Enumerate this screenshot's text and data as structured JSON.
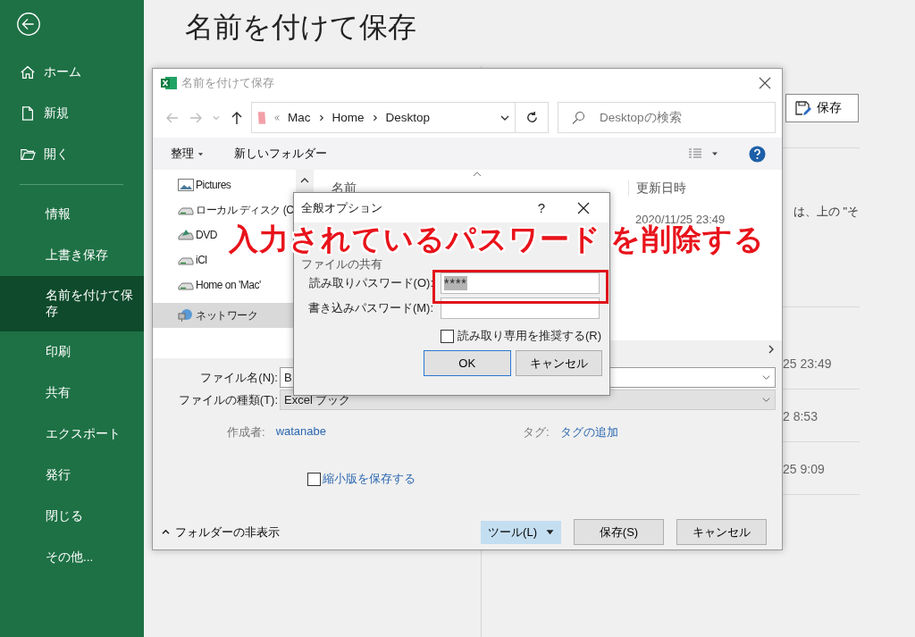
{
  "sidebar": {
    "items": [
      {
        "label": "ホーム",
        "kind": "home",
        "selected": false
      },
      {
        "label": "新規",
        "kind": "new",
        "selected": false
      },
      {
        "label": "開く",
        "kind": "open",
        "selected": false
      },
      {
        "label": "情報",
        "kind": "page",
        "selected": false
      },
      {
        "label": "上書き保存",
        "kind": "page",
        "selected": false
      },
      {
        "label": "名前を付けて保存",
        "kind": "page",
        "selected": true
      },
      {
        "label": "印刷",
        "kind": "page",
        "selected": false
      },
      {
        "label": "共有",
        "kind": "page",
        "selected": false
      },
      {
        "label": "エクスポート",
        "kind": "page",
        "selected": false
      },
      {
        "label": "発行",
        "kind": "page",
        "selected": false
      },
      {
        "label": "閉じる",
        "kind": "page",
        "selected": false
      },
      {
        "label": "その他...",
        "kind": "page",
        "selected": false
      }
    ]
  },
  "page_title": "名前を付けて保存",
  "backstage": {
    "save_button": "保存",
    "note": "は、上の \"そ",
    "times": [
      "25 23:49",
      "2 8:53",
      "25 9:09"
    ]
  },
  "save_dialog": {
    "title": "名前を付けて保存",
    "breadcrumb": [
      "Mac",
      "Home",
      "Desktop"
    ],
    "search": {
      "placeholder": "Desktopの検索"
    },
    "toolbar": {
      "organize": "整理",
      "new_folder": "新しいフォルダー"
    },
    "nav": [
      {
        "label": "Pictures",
        "kind": "pictures",
        "selected": false
      },
      {
        "label": "ローカル ディスク (C",
        "kind": "drive",
        "selected": false
      },
      {
        "label": "DVD",
        "kind": "dvd",
        "selected": false
      },
      {
        "label": "iCl",
        "kind": "drive",
        "selected": false
      },
      {
        "label": "Home on 'Mac'",
        "kind": "drive",
        "selected": false
      },
      {
        "label": "ネットワーク",
        "kind": "network",
        "selected": true
      }
    ],
    "columns": [
      "名前",
      "更新日時"
    ],
    "rows": [
      {
        "date": "2020/11/25 23:49"
      }
    ],
    "file_name": {
      "label": "ファイル名(N):",
      "value": "B"
    },
    "file_type": {
      "label": "ファイルの種類(T):",
      "value": "Excel ブック"
    },
    "author": {
      "label": "作成者:",
      "value": "watanabe"
    },
    "tags": {
      "label": "タグ:",
      "value": "タグの追加"
    },
    "thumbnail": {
      "label": "縮小版を保存する",
      "checked": false
    },
    "hide_folders": "フォルダーの非表示",
    "tools": "ツール(L)",
    "save": "保存(S)",
    "cancel": "キャンセル"
  },
  "options_dialog": {
    "title": "全般オプション",
    "help": "?",
    "section": "ファイルの共有",
    "read_password": {
      "label": "読み取りパスワード(O):",
      "value": "****",
      "selected": true
    },
    "write_password": {
      "label": "書き込みパスワード(M):"
    },
    "recommend_readonly": {
      "label": "読み取り専用を推奨する(R)",
      "checked": false
    },
    "ok": "OK",
    "cancel": "キャンセル"
  },
  "annotation": {
    "text": "入力されているパスワード を削除する"
  }
}
